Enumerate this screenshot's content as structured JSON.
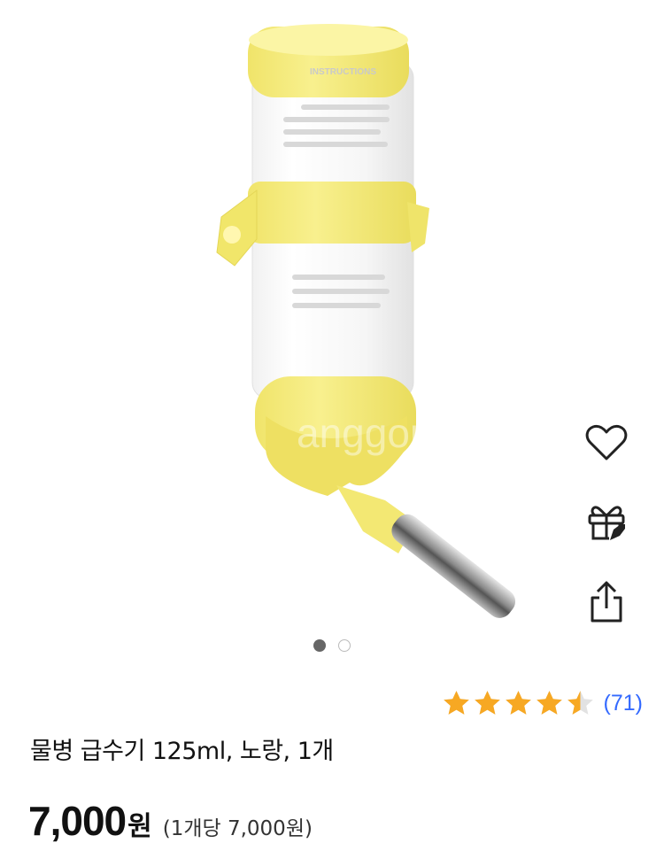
{
  "product": {
    "title": "물병 급수기 125ml, 노랑, 1개",
    "price": "7,000",
    "currency": "원",
    "unit_price": "(1개당 7,000원)",
    "image_watermark": "anggong",
    "bottle_label": "INSTRUCTIONS"
  },
  "rating": {
    "stars": 4.5,
    "max": 5,
    "review_count": "(71)"
  },
  "gallery": {
    "total": 2,
    "current": 1
  },
  "side_actions": [
    {
      "icon": "heart-icon"
    },
    {
      "icon": "gift-icon"
    },
    {
      "icon": "share-icon"
    }
  ],
  "colors": {
    "star": "#f7a823",
    "link": "#346aff",
    "bottle_yellow": "#f3ea7a"
  }
}
